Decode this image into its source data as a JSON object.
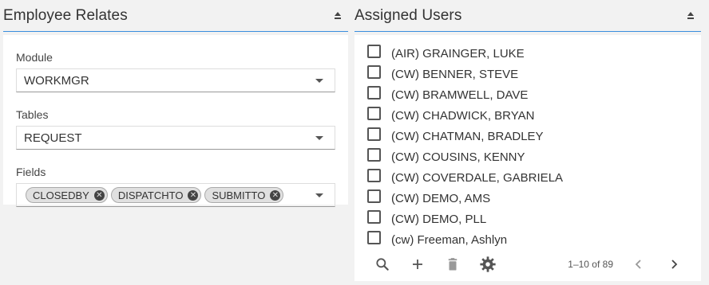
{
  "left_panel": {
    "title": "Employee Relates",
    "module": {
      "label": "Module",
      "value": "WORKMGR"
    },
    "tables": {
      "label": "Tables",
      "value": "REQUEST"
    },
    "fields": {
      "label": "Fields",
      "chips": [
        "CLOSEDBY",
        "DISPATCHTO",
        "SUBMITTO"
      ]
    }
  },
  "right_panel": {
    "title": "Assigned Users",
    "users": [
      "(AIR) GRAINGER, LUKE",
      "(CW) BENNER, STEVE",
      "(CW) BRAMWELL, DAVE",
      "(CW) CHADWICK, BRYAN",
      "(CW) CHATMAN, BRADLEY",
      "(CW) COUSINS, KENNY",
      "(CW) COVERDALE, GABRIELA",
      "(CW) DEMO, AMS",
      "(CW) DEMO, PLL",
      "(cw) Freeman, Ashlyn"
    ],
    "pagination": "1–10 of 89"
  },
  "icons": {
    "search": "search-icon",
    "add": "plus-icon",
    "delete": "trash-icon",
    "settings": "gear-icon",
    "prev": "chevron-left-icon",
    "next": "chevron-right-icon",
    "collapse": "collapse-icon",
    "chip_remove": "close-circle-icon",
    "dropdown": "caret-down-icon"
  },
  "colors": {
    "accent": "#3a8dde"
  }
}
